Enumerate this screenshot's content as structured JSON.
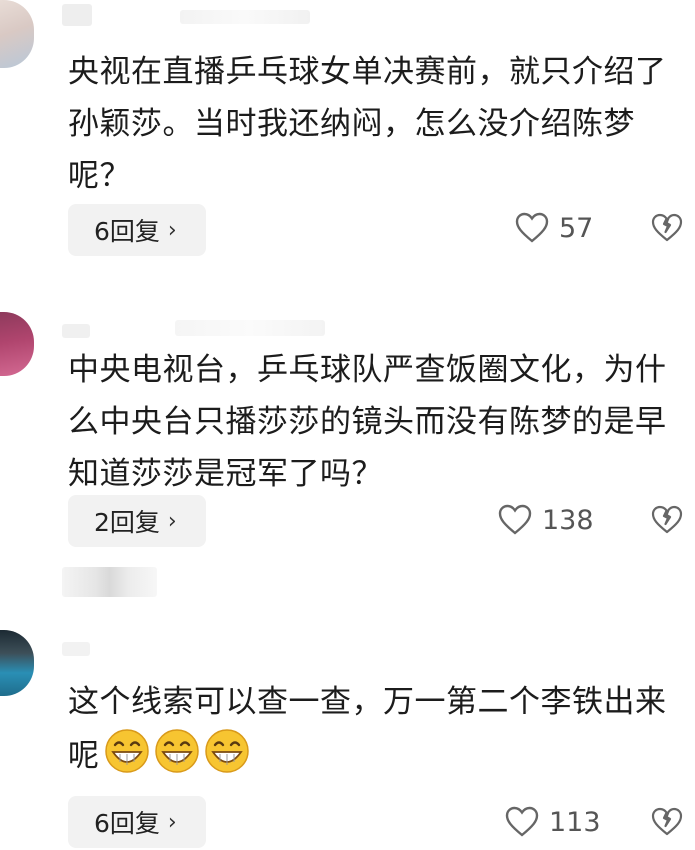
{
  "comments": [
    {
      "text": "央视在直播乒乓球女单决赛前，就只介绍了孙颖莎。当时我还纳闷，怎么没介绍陈梦呢？",
      "reply_label": "6回复",
      "likes": "57",
      "avatar_colors": [
        "#d9c9c4",
        "#b8c8d8",
        "#e8dcd6"
      ]
    },
    {
      "text": "中央电视台，乒乓球队严查饭圈文化，为什么中央台只播莎莎的镜头而没有陈梦的是早知道莎莎是冠军了吗？",
      "reply_label": "2回复",
      "likes": "138",
      "avatar_colors": [
        "#b0456e",
        "#d46a93",
        "#8e3a5c"
      ]
    },
    {
      "text": "这个线索可以查一查，万一第二个李铁出来呢",
      "reply_label": "6回复",
      "likes": "113",
      "avatar_colors": [
        "#1c2a33",
        "#2a8fb5",
        "#3d4f58"
      ],
      "emojis": [
        "grin-icon",
        "grin-icon",
        "grin-icon"
      ]
    }
  ],
  "icons": {
    "like": "heart-outline-icon",
    "dislike": "broken-heart-icon",
    "chevron": "›"
  }
}
